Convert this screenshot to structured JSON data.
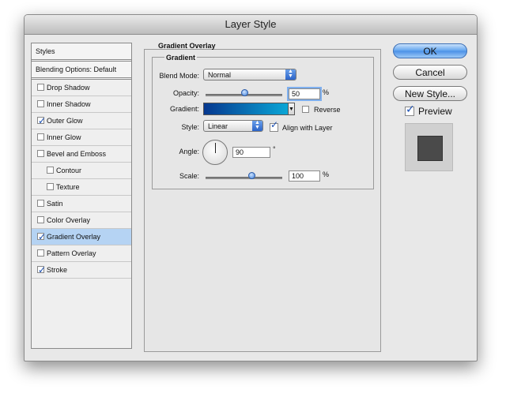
{
  "window": {
    "title": "Layer Style"
  },
  "styles_list": {
    "header": "Styles",
    "blending": "Blending Options: Default",
    "items": [
      {
        "label": "Drop Shadow",
        "checked": false,
        "sub": false,
        "selected": false
      },
      {
        "label": "Inner Shadow",
        "checked": false,
        "sub": false,
        "selected": false
      },
      {
        "label": "Outer Glow",
        "checked": true,
        "sub": false,
        "selected": false
      },
      {
        "label": "Inner Glow",
        "checked": false,
        "sub": false,
        "selected": false
      },
      {
        "label": "Bevel and Emboss",
        "checked": false,
        "sub": false,
        "selected": false
      },
      {
        "label": "Contour",
        "checked": false,
        "sub": true,
        "selected": false
      },
      {
        "label": "Texture",
        "checked": false,
        "sub": true,
        "selected": false
      },
      {
        "label": "Satin",
        "checked": false,
        "sub": false,
        "selected": false
      },
      {
        "label": "Color Overlay",
        "checked": false,
        "sub": false,
        "selected": false
      },
      {
        "label": "Gradient Overlay",
        "checked": true,
        "sub": false,
        "selected": true
      },
      {
        "label": "Pattern Overlay",
        "checked": false,
        "sub": false,
        "selected": false
      },
      {
        "label": "Stroke",
        "checked": true,
        "sub": false,
        "selected": false
      }
    ]
  },
  "panel": {
    "title": "Gradient Overlay",
    "group_title": "Gradient",
    "blend_mode_label": "Blend Mode:",
    "blend_mode_value": "Normal",
    "opacity_label": "Opacity:",
    "opacity_value": "50",
    "opacity_unit": "%",
    "opacity_level": 0.5,
    "gradient_label": "Gradient:",
    "gradient_colors": [
      "#06388f",
      "#0aa6d6"
    ],
    "reverse_label": "Reverse",
    "reverse_checked": false,
    "style_label": "Style:",
    "style_value": "Linear",
    "align_label": "Align with Layer",
    "align_checked": true,
    "angle_label": "Angle:",
    "angle_value": "90",
    "angle_unit": "°",
    "scale_label": "Scale:",
    "scale_value": "100",
    "scale_unit": "%",
    "scale_level": 0.6
  },
  "buttons": {
    "ok": "OK",
    "cancel": "Cancel",
    "new_style": "New Style..."
  },
  "preview": {
    "label": "Preview",
    "checked": true
  }
}
